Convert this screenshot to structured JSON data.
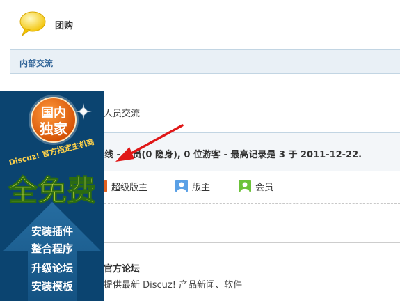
{
  "forum": {
    "name": "团购"
  },
  "category": {
    "title": "内部交流"
  },
  "subforum": {
    "description": "人员交流"
  },
  "online": {
    "text": "线 - 会员(0 隐身), 0 位游客 - 最高记录是 3 于 2011-12-22."
  },
  "legend": [
    {
      "label": "超级版主",
      "color": "#e06020"
    },
    {
      "label": "版主",
      "color": "#4a90d9"
    },
    {
      "label": "会员",
      "color": "#5cb82e"
    }
  ],
  "official": {
    "title": "官方论坛",
    "description": "提供最新 Discuz! 产品新闻、软件"
  },
  "ad": {
    "badge_line1": "国内",
    "badge_line2": "独家",
    "arc_text": "Discuz! 官方指定主机商",
    "headline": "全免费",
    "items": [
      "安装插件",
      "整合程序",
      "升级论坛",
      "安装模板"
    ]
  }
}
